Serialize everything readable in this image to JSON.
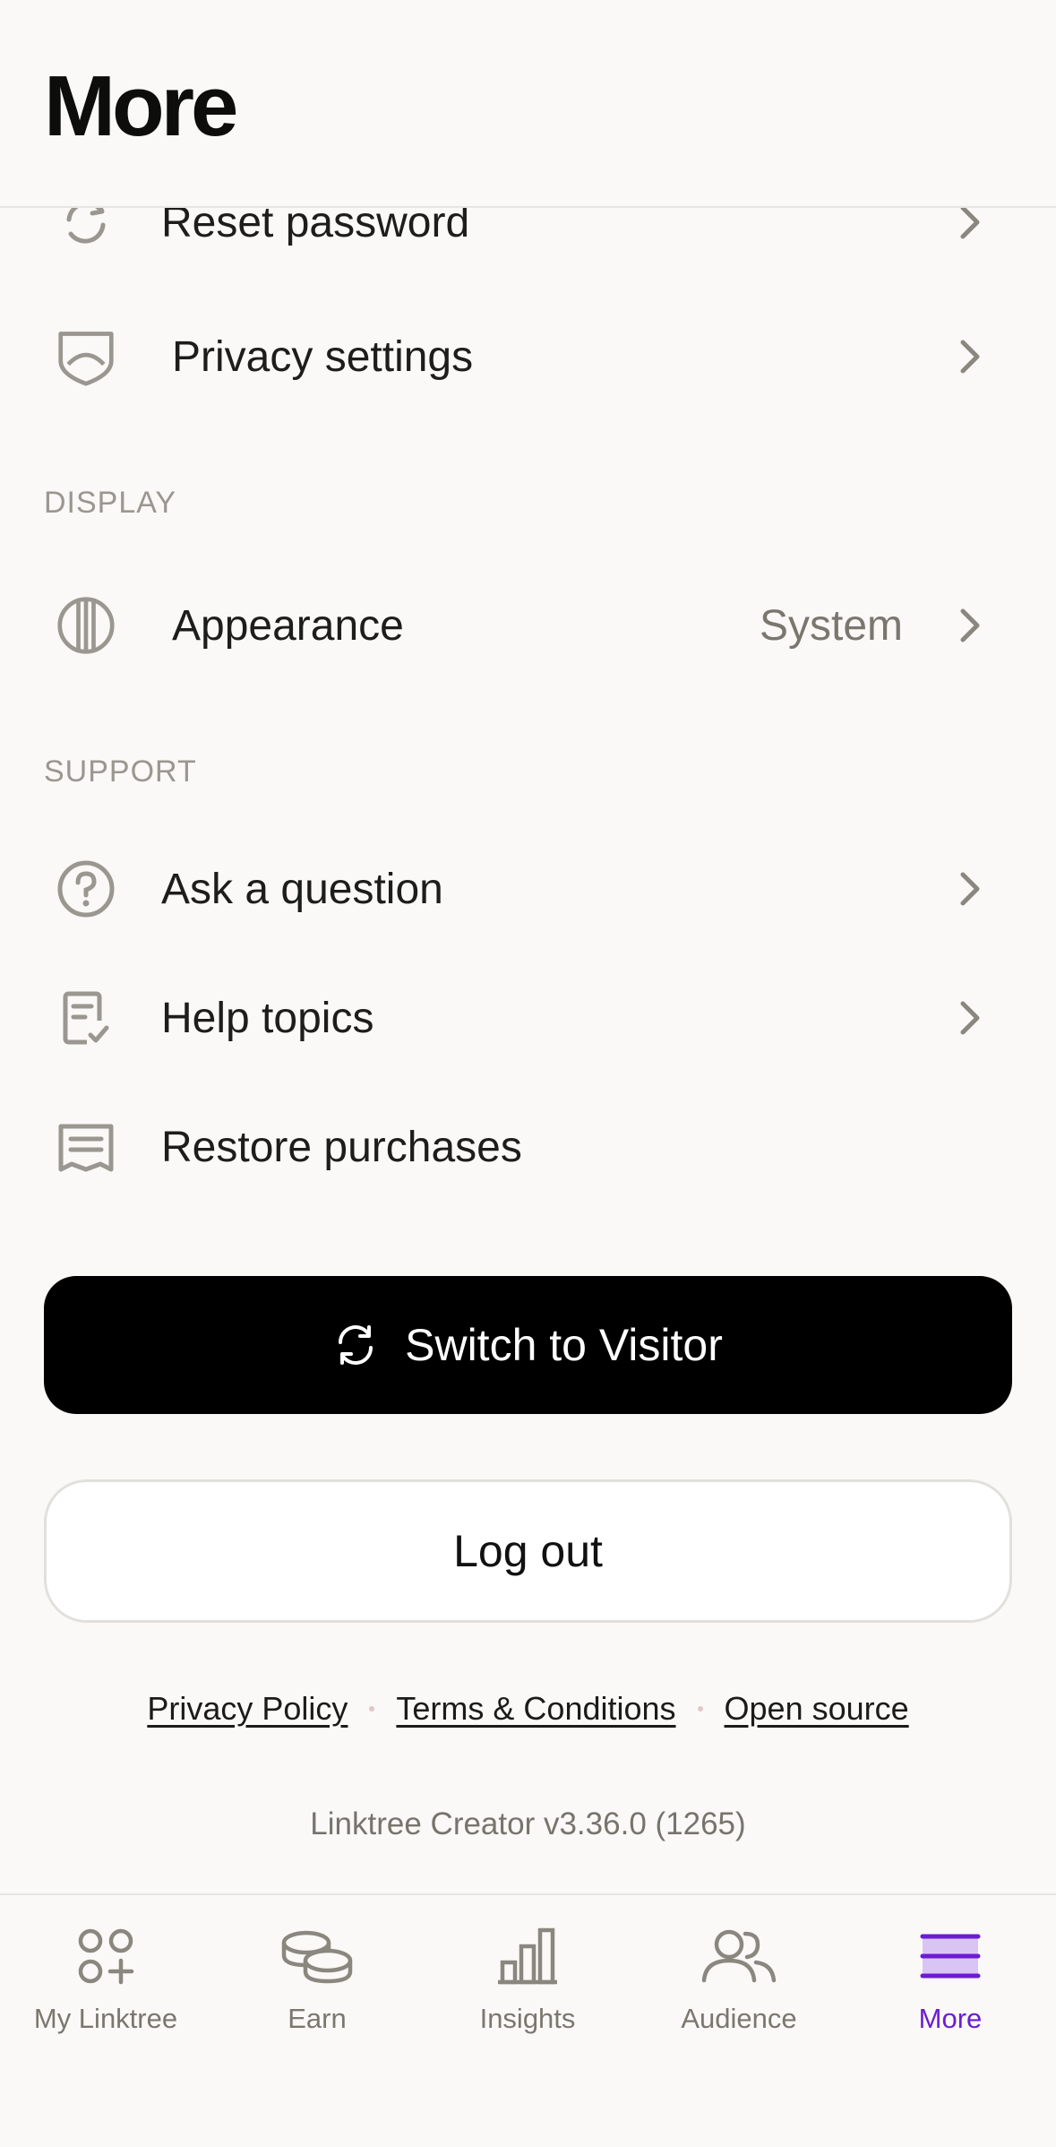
{
  "header": {
    "title": "More"
  },
  "account_rows": [
    {
      "label": "Reset password",
      "icon": "refresh-icon"
    },
    {
      "label": "Privacy settings",
      "icon": "shield-icon"
    }
  ],
  "display": {
    "section_label": "DISPLAY",
    "appearance": {
      "label": "Appearance",
      "value": "System",
      "icon": "contrast-circle-icon"
    }
  },
  "support": {
    "section_label": "SUPPORT",
    "rows": [
      {
        "label": "Ask a question",
        "icon": "question-circle-icon"
      },
      {
        "label": "Help topics",
        "icon": "document-check-icon"
      },
      {
        "label": "Restore purchases",
        "icon": "receipt-icon"
      }
    ]
  },
  "buttons": {
    "switch_label": "Switch to Visitor",
    "logout_label": "Log out"
  },
  "footer": {
    "privacy": "Privacy Policy",
    "terms": "Terms & Conditions",
    "open_source": "Open source",
    "version": "Linktree Creator v3.36.0 (1265)"
  },
  "tabbar": {
    "tabs": [
      {
        "label": "My Linktree",
        "icon": "shapes-icon"
      },
      {
        "label": "Earn",
        "icon": "coins-icon"
      },
      {
        "label": "Insights",
        "icon": "bar-chart-icon"
      },
      {
        "label": "Audience",
        "icon": "users-icon"
      },
      {
        "label": "More",
        "icon": "menu-icon",
        "active": true
      }
    ]
  },
  "colors": {
    "accent": "#6c1cd2",
    "icon_gray": "#9a9790",
    "text": "#1d1d1b"
  }
}
